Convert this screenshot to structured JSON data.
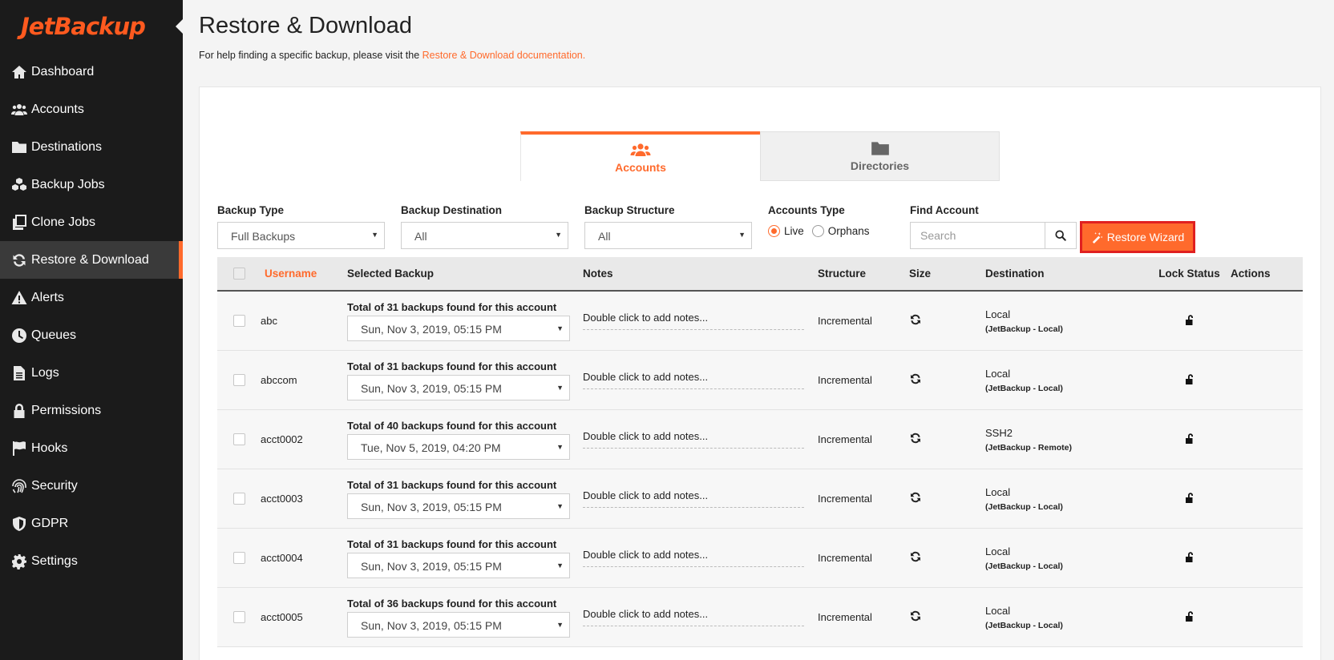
{
  "brand": {
    "logo_text": "JetBackup"
  },
  "sidebar": {
    "items": [
      {
        "label": "Dashboard",
        "icon": "home-icon"
      },
      {
        "label": "Accounts",
        "icon": "users-icon"
      },
      {
        "label": "Destinations",
        "icon": "folder-icon"
      },
      {
        "label": "Backup Jobs",
        "icon": "cubes-icon"
      },
      {
        "label": "Clone Jobs",
        "icon": "copy-icon"
      },
      {
        "label": "Restore & Download",
        "icon": "refresh-icon",
        "active": true
      },
      {
        "label": "Alerts",
        "icon": "warning-icon"
      },
      {
        "label": "Queues",
        "icon": "clock-icon"
      },
      {
        "label": "Logs",
        "icon": "file-icon"
      },
      {
        "label": "Permissions",
        "icon": "lock-icon"
      },
      {
        "label": "Hooks",
        "icon": "flag-icon"
      },
      {
        "label": "Security",
        "icon": "fingerprint-icon"
      },
      {
        "label": "GDPR",
        "icon": "shield-icon"
      },
      {
        "label": "Settings",
        "icon": "gear-icon"
      }
    ]
  },
  "page": {
    "title": "Restore & Download",
    "help_text": "For help finding a specific backup, please visit the ",
    "help_link": "Restore & Download documentation."
  },
  "tabs": [
    {
      "label": "Accounts",
      "icon": "users-icon",
      "active": true
    },
    {
      "label": "Directories",
      "icon": "folder-icon",
      "active": false
    }
  ],
  "filters": {
    "backup_type": {
      "label": "Backup Type",
      "value": "Full Backups"
    },
    "backup_destination": {
      "label": "Backup Destination",
      "value": "All"
    },
    "backup_structure": {
      "label": "Backup Structure",
      "value": "All"
    },
    "accounts_type": {
      "label": "Accounts Type",
      "options": [
        "Live",
        "Orphans"
      ],
      "selected": "Live"
    },
    "find_account": {
      "label": "Find Account",
      "placeholder": "Search"
    }
  },
  "restore_wizard_label": "Restore Wizard",
  "table": {
    "columns": {
      "username": "Username",
      "selected_backup": "Selected Backup",
      "notes": "Notes",
      "structure": "Structure",
      "size": "Size",
      "destination": "Destination",
      "lock_status": "Lock Status",
      "actions": "Actions"
    },
    "rows": [
      {
        "username": "abc",
        "total": "Total of 31 backups found for this account",
        "backup": "Sun, Nov 3, 2019, 05:15 PM",
        "notes": "Double click to add notes...",
        "structure": "Incremental",
        "dest": "Local",
        "dest_sub": "(JetBackup - Local)"
      },
      {
        "username": "abccom",
        "total": "Total of 31 backups found for this account",
        "backup": "Sun, Nov 3, 2019, 05:15 PM",
        "notes": "Double click to add notes...",
        "structure": "Incremental",
        "dest": "Local",
        "dest_sub": "(JetBackup - Local)"
      },
      {
        "username": "acct0002",
        "total": "Total of 40 backups found for this account",
        "backup": "Tue, Nov 5, 2019, 04:20 PM",
        "notes": "Double click to add notes...",
        "structure": "Incremental",
        "dest": "SSH2",
        "dest_sub": "(JetBackup - Remote)"
      },
      {
        "username": "acct0003",
        "total": "Total of 31 backups found for this account",
        "backup": "Sun, Nov 3, 2019, 05:15 PM",
        "notes": "Double click to add notes...",
        "structure": "Incremental",
        "dest": "Local",
        "dest_sub": "(JetBackup - Local)"
      },
      {
        "username": "acct0004",
        "total": "Total of 31 backups found for this account",
        "backup": "Sun, Nov 3, 2019, 05:15 PM",
        "notes": "Double click to add notes...",
        "structure": "Incremental",
        "dest": "Local",
        "dest_sub": "(JetBackup - Local)"
      },
      {
        "username": "acct0005",
        "total": "Total of 36 backups found for this account",
        "backup": "Sun, Nov 3, 2019, 05:15 PM",
        "notes": "Double click to add notes...",
        "structure": "Incremental",
        "dest": "Local",
        "dest_sub": "(JetBackup - Local)"
      }
    ]
  },
  "colors": {
    "accent": "#ff6a2c",
    "sidebar_bg": "#1b1b1b",
    "wizard_border": "#e02020"
  }
}
